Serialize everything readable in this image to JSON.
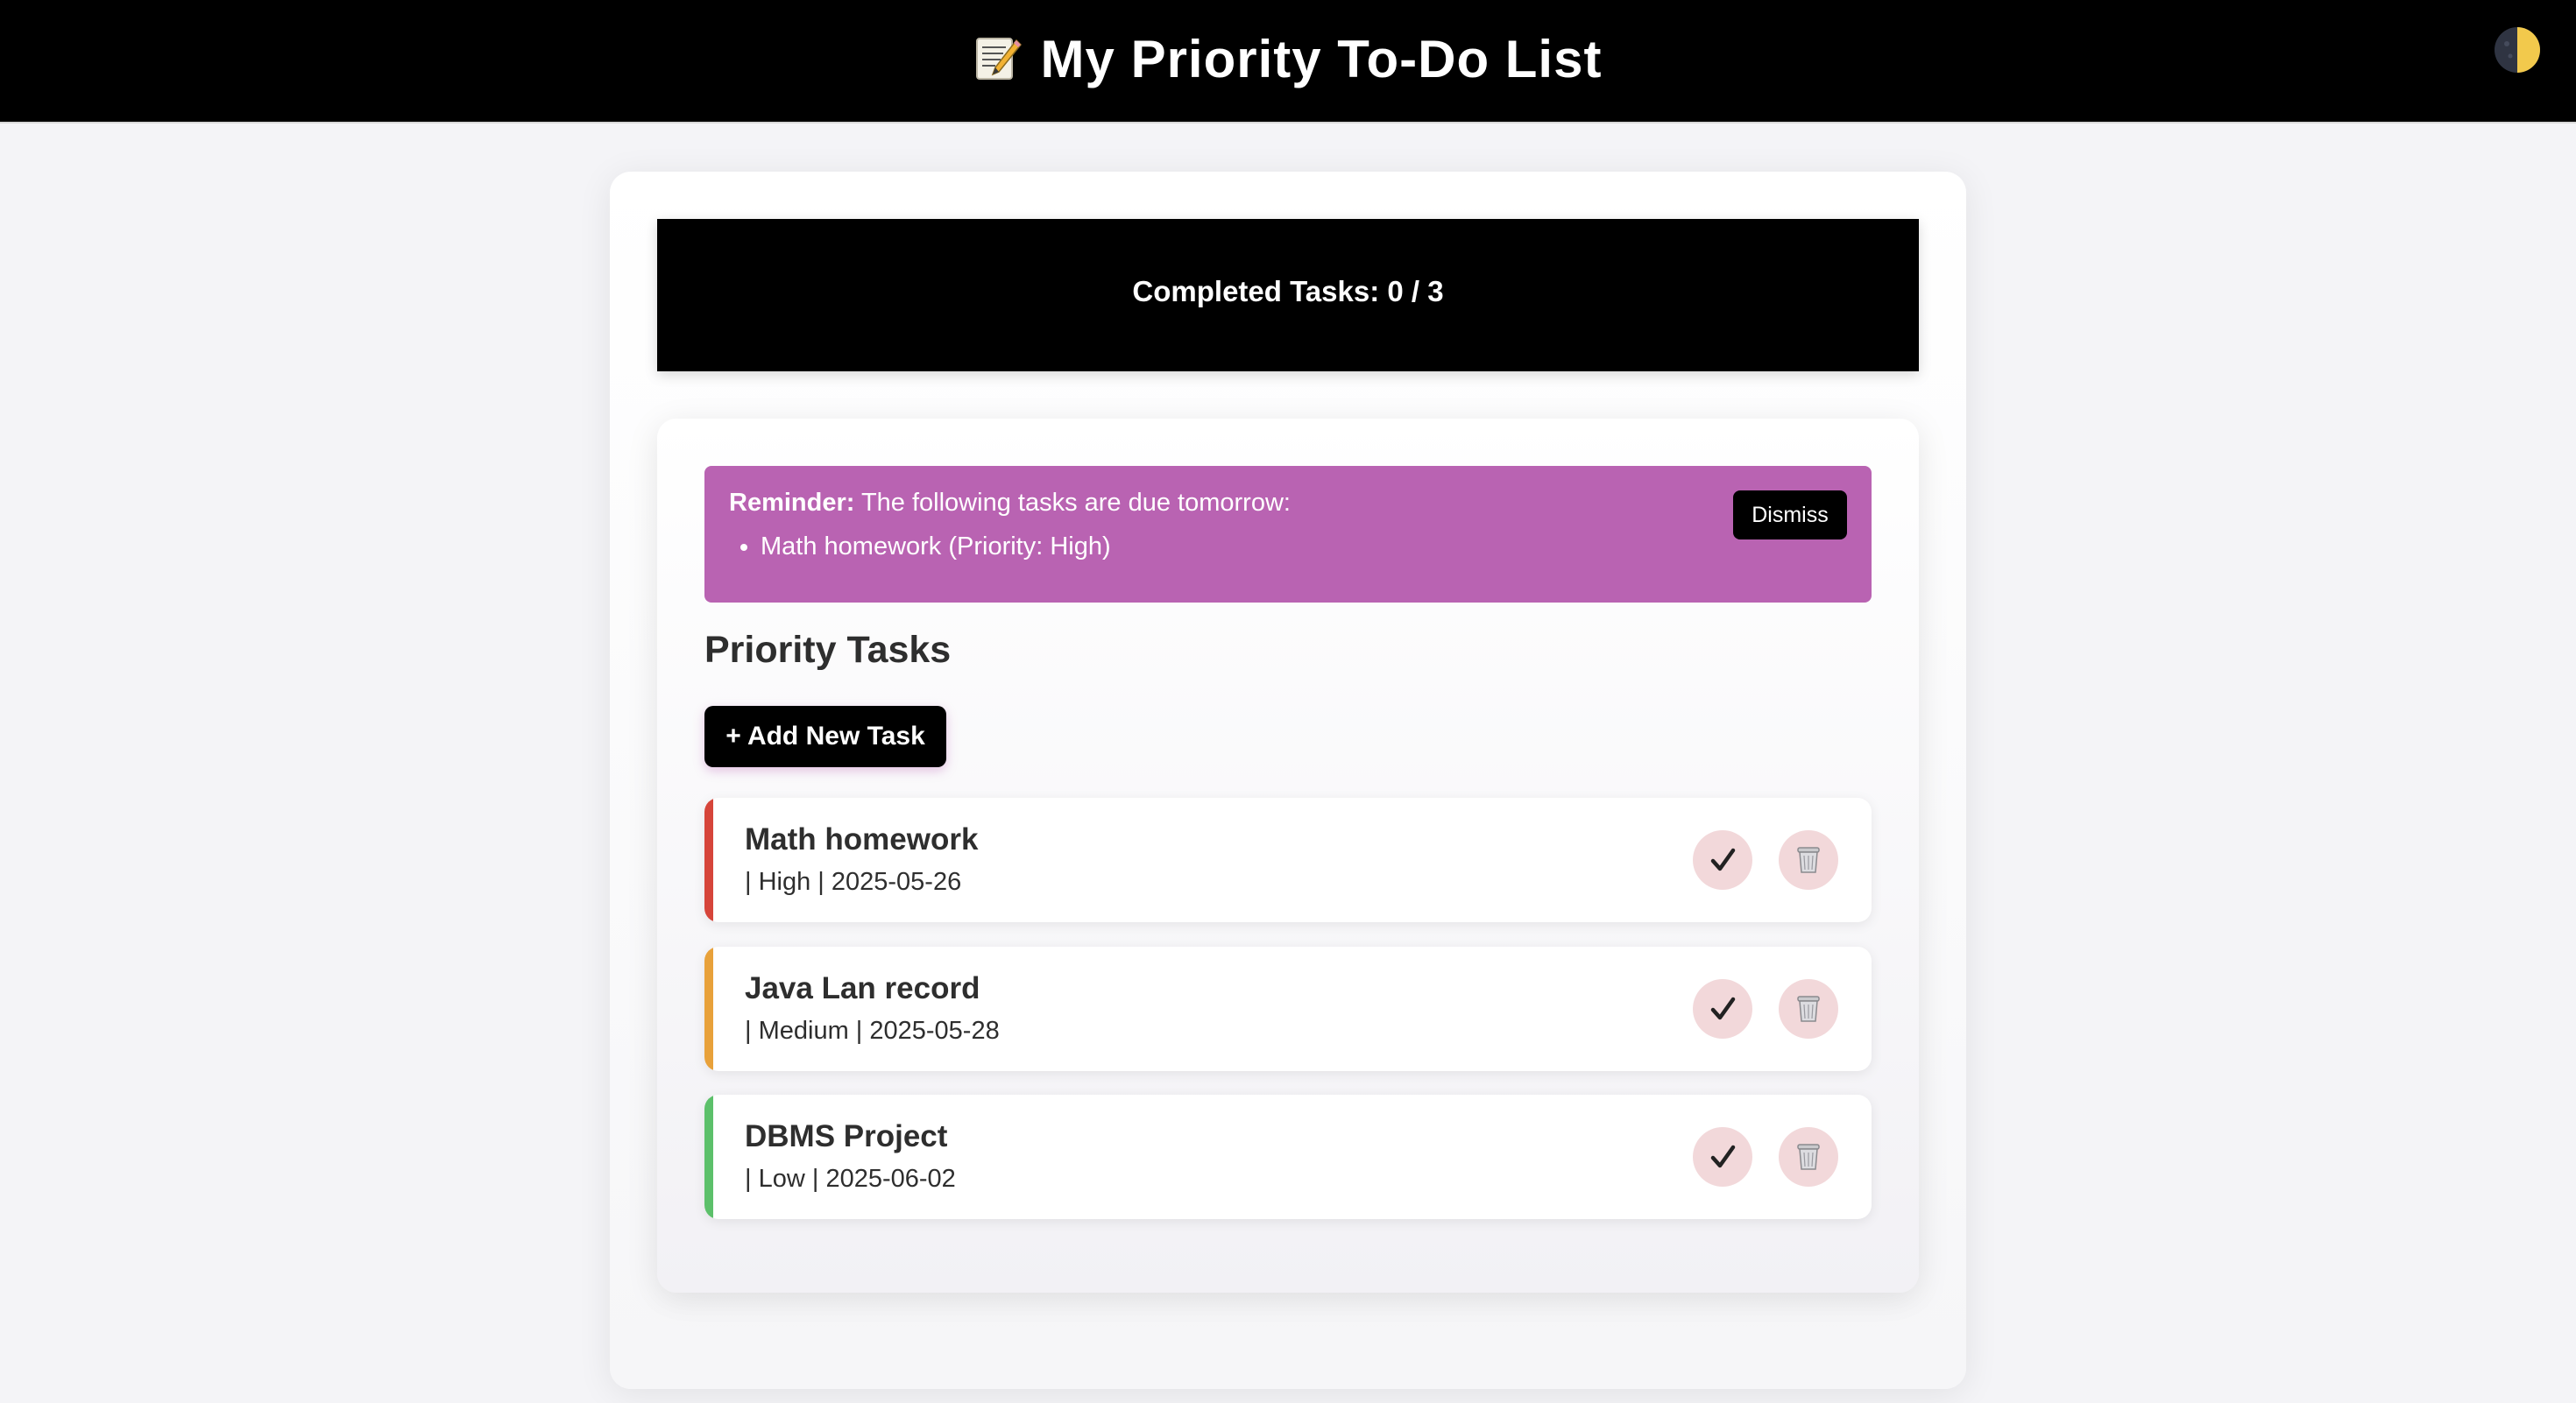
{
  "header": {
    "title": "My Priority To-Do List",
    "title_icon": "memo-icon",
    "theme_toggle_icon": "half-moon-icon"
  },
  "progress": {
    "text": "Completed Tasks: 0 / 3",
    "completed": 0,
    "total": 3
  },
  "reminder": {
    "label": "Reminder:",
    "message": " The following tasks are due tomorrow:",
    "items": [
      "Math homework (Priority: High)"
    ],
    "dismiss_label": "Dismiss",
    "background_color": "#b963b2"
  },
  "tasks_section": {
    "title": "Priority Tasks",
    "add_button_label": "+ Add New Task",
    "tasks": [
      {
        "name": "Math homework",
        "meta": "| High | 2025-05-26",
        "priority": "High",
        "due": "2025-05-26",
        "color": "#d6453a"
      },
      {
        "name": "Java Lan record",
        "meta": "| Medium | 2025-05-28",
        "priority": "Medium",
        "due": "2025-05-28",
        "color": "#e8a13a"
      },
      {
        "name": "DBMS Project",
        "meta": "| Low | 2025-06-02",
        "priority": "Low",
        "due": "2025-06-02",
        "color": "#5cc06a"
      }
    ],
    "complete_icon": "checkmark-icon",
    "delete_icon": "trash-can-icon"
  }
}
